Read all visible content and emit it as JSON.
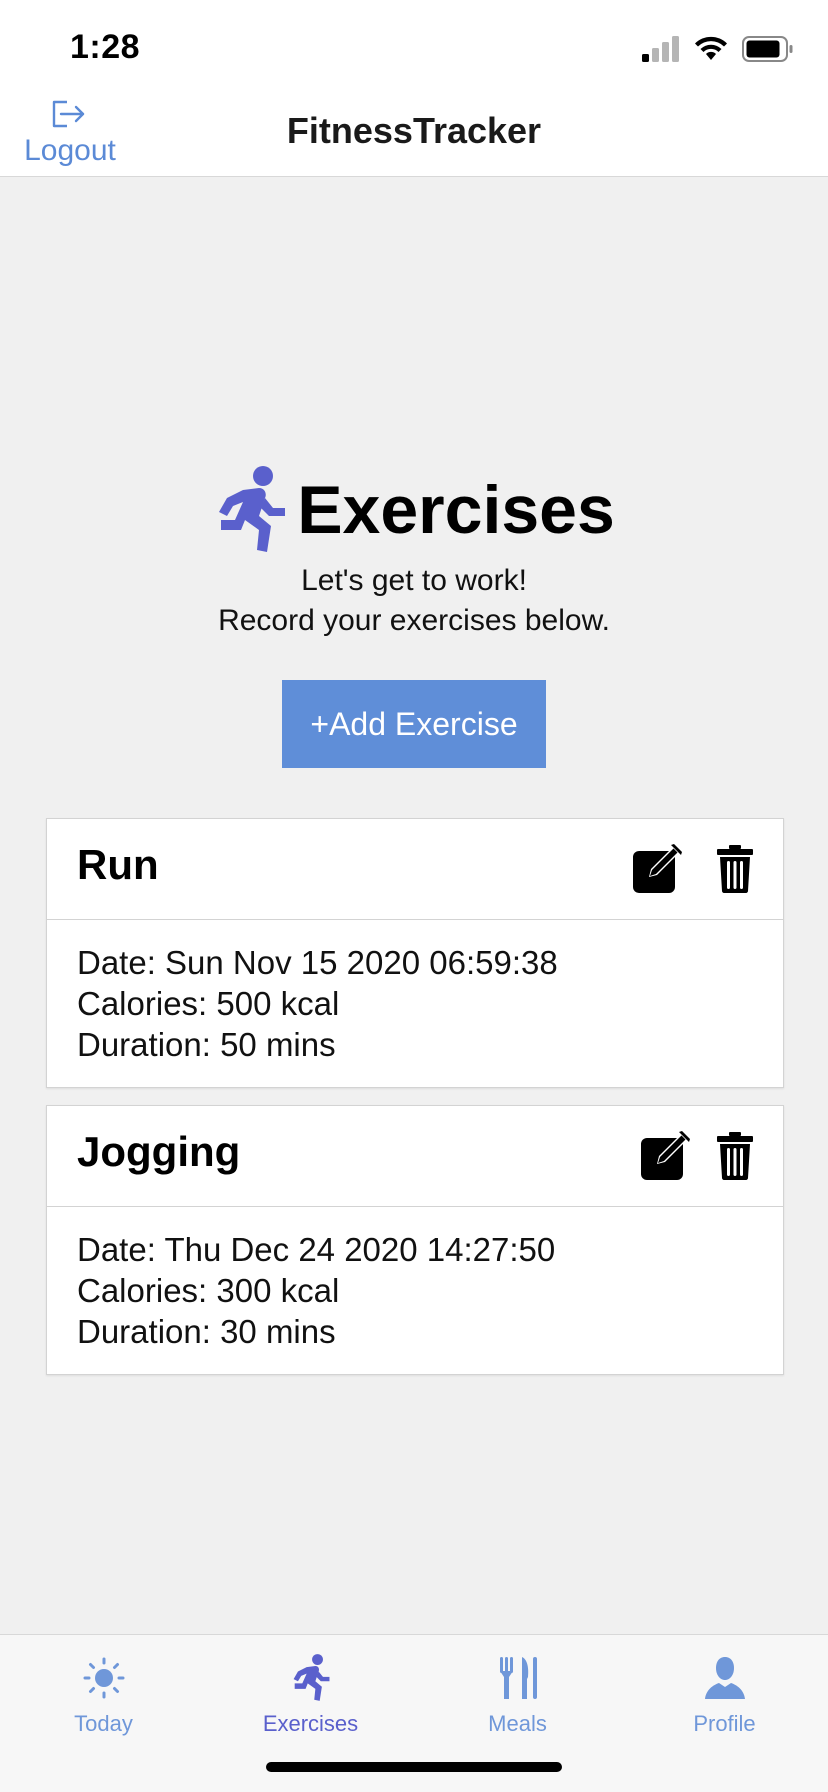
{
  "status_bar": {
    "time": "1:28"
  },
  "nav": {
    "logout_label": "Logout",
    "title": "FitnessTracker"
  },
  "main": {
    "heading": "Exercises",
    "subtitle_line1": "Let's get to work!",
    "subtitle_line2": "Record your exercises below.",
    "add_button_label": "+Add Exercise"
  },
  "exercises": [
    {
      "name": "Run",
      "date": "Date: Sun Nov 15 2020 06:59:38",
      "calories": "Calories: 500 kcal",
      "duration": "Duration: 50 mins"
    },
    {
      "name": "Jogging",
      "date": "Date: Thu Dec 24 2020 14:27:50",
      "calories": "Calories: 300 kcal",
      "duration": "Duration: 30 mins"
    }
  ],
  "tabs": [
    {
      "label": "Today",
      "icon": "sun-icon",
      "active": false
    },
    {
      "label": "Exercises",
      "icon": "running-icon",
      "active": true
    },
    {
      "label": "Meals",
      "icon": "utensils-icon",
      "active": false
    },
    {
      "label": "Profile",
      "icon": "user-icon",
      "active": false
    }
  ],
  "colors": {
    "accent": "#5b8ad6",
    "active_tab": "#5a60cc",
    "button_bg": "#5f8ed8",
    "background": "#f0f0f0"
  }
}
